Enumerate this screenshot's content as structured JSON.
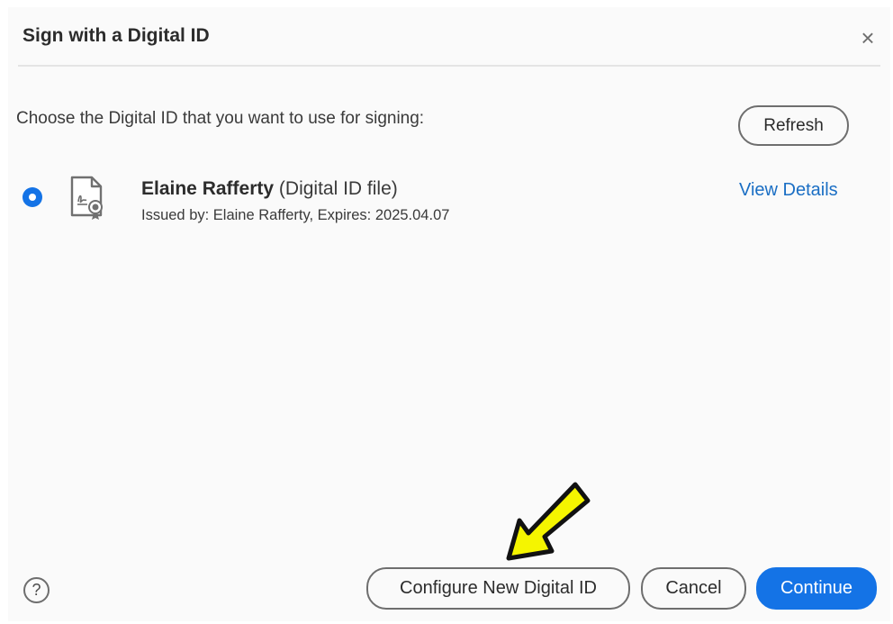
{
  "dialog": {
    "title": "Sign with a Digital ID",
    "close_glyph": "×",
    "prompt": "Choose the Digital ID that you want to use for signing:",
    "refresh_label": "Refresh",
    "digital_id": {
      "name": "Elaine Rafferty",
      "type": "(Digital ID file)",
      "issued": "Issued by: Elaine Rafferty, Expires: 2025.04.07",
      "selected": true,
      "icon": "certificate-file-icon"
    },
    "view_details_label": "View Details",
    "help_glyph": "?",
    "footer": {
      "configure_label": "Configure New Digital ID",
      "cancel_label": "Cancel",
      "continue_label": "Continue"
    }
  },
  "annotation": {
    "icon": "arrow-pointer-icon",
    "color": "#f5f500"
  },
  "colors": {
    "accent": "#1473e6",
    "link": "#1a6ec4",
    "background": "#fafafa"
  }
}
